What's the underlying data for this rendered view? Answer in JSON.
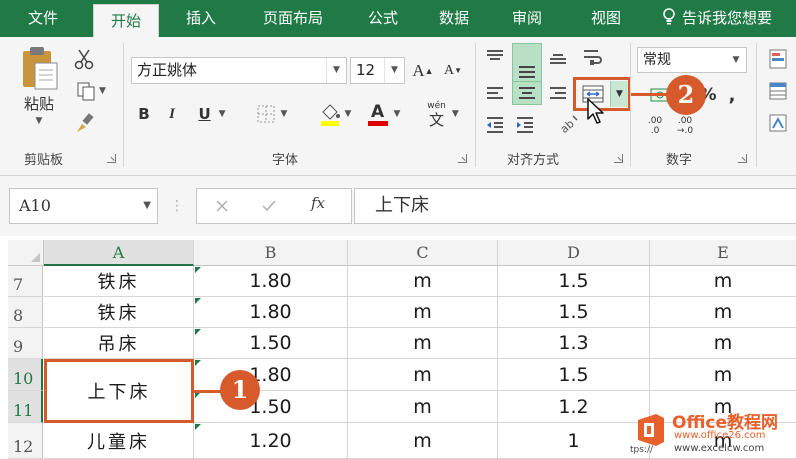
{
  "tabs": {
    "file": "文件",
    "home": "开始",
    "insert": "插入",
    "page_layout": "页面布局",
    "formulas": "公式",
    "data": "数据",
    "review": "审阅",
    "view": "视图"
  },
  "tell_me": "告诉我您想要",
  "ribbon": {
    "clipboard": {
      "paste_label": "粘贴",
      "group_label": "剪贴板"
    },
    "font": {
      "font_name": "方正姚体",
      "font_size": "12",
      "bold": "B",
      "italic": "I",
      "underline": "U",
      "increase_size": "A",
      "decrease_size": "A",
      "font_color_letter": "A",
      "phonetic": "wén",
      "group_label": "字体"
    },
    "alignment": {
      "group_label": "对齐方式"
    },
    "number": {
      "format": "常规",
      "percent": "%",
      "comma": ",",
      "inc_decimal_top": ".00",
      "inc_decimal_bottom": ".0",
      "dec_decimal_top": ".00",
      "dec_decimal_bottom": "→.0",
      "group_label": "数字"
    }
  },
  "formula_bar": {
    "name_box": "A10",
    "fx": "fx",
    "content": "上下床"
  },
  "sheet": {
    "columns": [
      "A",
      "B",
      "C",
      "D",
      "E"
    ],
    "rows": [
      {
        "num": "7",
        "a": "铁床",
        "b": "1.80",
        "c": "m",
        "d": "1.5",
        "e": "m"
      },
      {
        "num": "8",
        "a": "铁床",
        "b": "1.80",
        "c": "m",
        "d": "1.5",
        "e": "m"
      },
      {
        "num": "9",
        "a": "吊床",
        "b": "1.50",
        "c": "m",
        "d": "1.3",
        "e": "m"
      },
      {
        "num": "10",
        "a": "上下床",
        "b": "1.80",
        "c": "m",
        "d": "1.5",
        "e": "m"
      },
      {
        "num": "11",
        "a": "",
        "b": "1.50",
        "c": "m",
        "d": "1.2",
        "e": "m"
      },
      {
        "num": "12",
        "a": "儿童床",
        "b": "1.20",
        "c": "m",
        "d": "1",
        "e": "m"
      }
    ]
  },
  "callouts": {
    "one": "1",
    "two": "2"
  },
  "watermark": {
    "title": "Office教程网",
    "url": "www.office26.com",
    "url2": "www.excelcw.com",
    "prefix": "tps://"
  },
  "colors": {
    "excel_green": "#217346",
    "callout": "#d65a2c"
  }
}
